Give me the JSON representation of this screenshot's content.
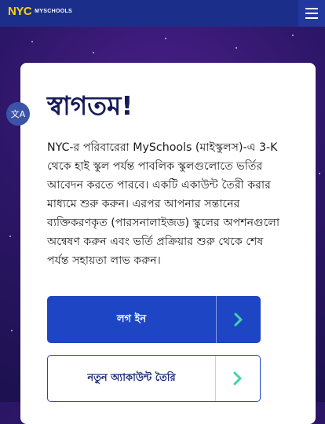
{
  "header": {
    "logo_nyc": "NYC",
    "logo_myschools": "MYSCHOOLS",
    "menu_icon": "hamburger-menu-icon"
  },
  "translate": {
    "icon": "translate-icon",
    "glyph": "文A"
  },
  "welcome": {
    "title": "স্বাগতম!",
    "body": "NYC-র পরিবারেরা MySchools (মাইস্কুলস)-এ 3-K থেকে হাই স্কুল পর্যন্ত পাবলিক স্কুলগুলোতে ভর্তির আবেদন করতে পারবে। একটি একাউন্ট তৈরী করার মাধ্যমে শুরু করুন। এরপর আপনার সন্তানের ব্যক্তিকরণকৃত (পারসনালাইজড) স্কুলের অপশনগুলো অন্বেষণ করুন এবং ভর্তি প্রক্রিয়ার শুরু থেকে শেষ পর্যন্ত সহায়তা লাভ করুন।"
  },
  "buttons": {
    "login": {
      "label": "লগ ইন",
      "icon": "chevron-right-icon"
    },
    "create_account": {
      "label": "নতুন অ্যাকাউন্ট তৈরি",
      "icon": "chevron-right-icon"
    }
  },
  "colors": {
    "header_bg": "#1b2f8a",
    "logo_yellow": "#ffd200",
    "title": "#161b5a",
    "primary": "#1e46c4",
    "chevron": "#3fd4a8"
  }
}
